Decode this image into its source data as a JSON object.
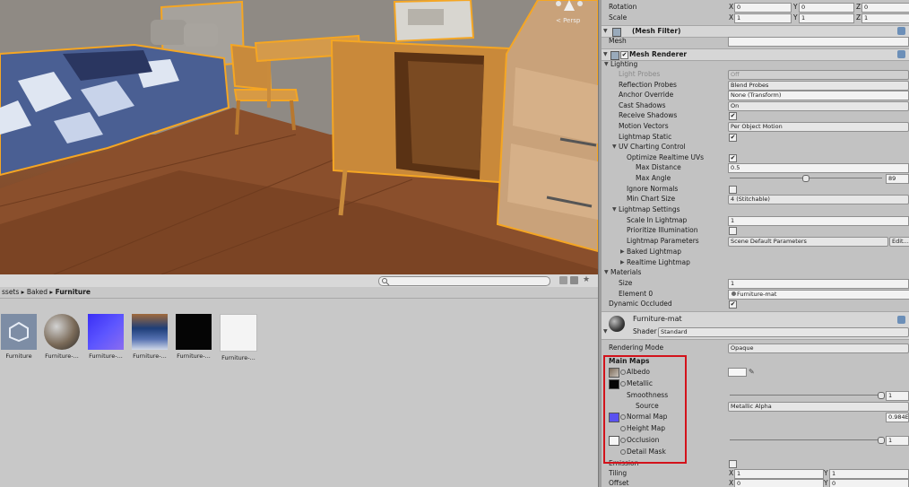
{
  "scene": {
    "gizmo_label": "< Persp"
  },
  "project": {
    "breadcrumb_prefix": "ssets",
    "breadcrumb_sep1": "▸",
    "breadcrumb_mid": "Baked",
    "breadcrumb_sep2": "▸",
    "breadcrumb_current": "Furniture",
    "assets": [
      {
        "label": "Furniture",
        "icon": "unity-prefab-icon"
      },
      {
        "label": "Furniture-...",
        "icon": "material-sphere-icon"
      },
      {
        "label": "Furniture-...",
        "icon": "normal-map-icon"
      },
      {
        "label": "Furniture-...",
        "icon": "lightmap-texture-icon"
      },
      {
        "label": "Furniture-...",
        "icon": "black-texture-icon"
      },
      {
        "label": "Furniture-...",
        "icon": "white-texture-icon"
      }
    ]
  },
  "transform": {
    "rotation_label": "Rotation",
    "scale_label": "Scale",
    "x": "X",
    "y": "Y",
    "z": "Z",
    "rotation": {
      "x": "0",
      "y": "0",
      "z": "0"
    },
    "scale": {
      "x": "1",
      "y": "1",
      "z": "1"
    }
  },
  "mesh_filter": {
    "title": "(Mesh Filter)",
    "mesh_label": "Mesh",
    "mesh_value": ""
  },
  "mesh_renderer": {
    "title": "Mesh Renderer",
    "lighting": "Lighting",
    "light_probes_label": "Light Probes",
    "light_probes_value": "Off",
    "reflection_probes_label": "Reflection Probes",
    "reflection_probes_value": "Blend Probes",
    "anchor_override_label": "Anchor Override",
    "anchor_override_value": "None (Transform)",
    "cast_shadows_label": "Cast Shadows",
    "cast_shadows_value": "On",
    "receive_shadows_label": "Receive Shadows",
    "motion_vectors_label": "Motion Vectors",
    "motion_vectors_value": "Per Object Motion",
    "lightmap_static_label": "Lightmap Static",
    "uv_charting_label": "UV Charting Control",
    "optimize_uvs_label": "Optimize Realtime UVs",
    "max_distance_label": "Max Distance",
    "max_distance_value": "0.5",
    "max_angle_label": "Max Angle",
    "max_angle_value": "89",
    "ignore_normals_label": "Ignore Normals",
    "min_chart_label": "Min Chart Size",
    "min_chart_value": "4 (Stitchable)",
    "lightmap_settings_label": "Lightmap Settings",
    "scale_in_lightmap_label": "Scale In Lightmap",
    "scale_in_lightmap_value": "1",
    "prioritize_label": "Prioritize Illumination",
    "lightmap_params_label": "Lightmap Parameters",
    "lightmap_params_value": "Scene Default Parameters",
    "edit_label": "Edit...",
    "baked_lightmap_label": "Baked Lightmap",
    "realtime_lightmap_label": "Realtime Lightmap",
    "materials_label": "Materials",
    "size_label": "Size",
    "size_value": "1",
    "element0_label": "Element 0",
    "element0_value": "Furniture-mat",
    "dynamic_occluded_label": "Dynamic Occluded"
  },
  "material": {
    "name": "Furniture-mat",
    "shader_label": "Shader",
    "shader_value": "Standard",
    "rendering_mode_label": "Rendering Mode",
    "rendering_mode_value": "Opaque",
    "main_maps_label": "Main Maps",
    "albedo_label": "Albedo",
    "metallic_label": "Metallic",
    "smoothness_label": "Smoothness",
    "smoothness_value": "1",
    "source_label": "Source",
    "source_value": "Metallic Alpha",
    "normal_map_label": "Normal Map",
    "normal_map_value": "0.984E",
    "height_map_label": "Height Map",
    "occlusion_label": "Occlusion",
    "occlusion_value": "1",
    "detail_mask_label": "Detail Mask",
    "emission_label": "Emission",
    "tiling_label": "Tiling",
    "offset_label": "Offset",
    "tiling": {
      "x": "1",
      "y": "1"
    },
    "offset": {
      "x": "0",
      "y": "0"
    }
  },
  "colors": {
    "highlight_box": "#d3121b",
    "selection_outline": "#f5a623"
  }
}
